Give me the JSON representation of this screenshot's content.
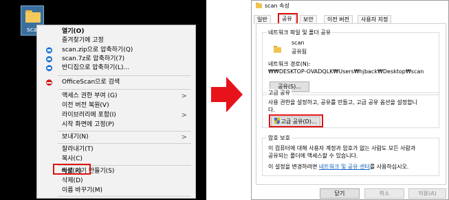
{
  "desktop": {
    "icon_label": "sca"
  },
  "context_menu": {
    "items": [
      {
        "label": "열기(O)",
        "bold": true
      },
      {
        "label": "즐겨찾기에 고정"
      },
      {
        "label": "scan.zip으로 압축하기(Q)",
        "icon": "bandizip-blue-icon"
      },
      {
        "label": "scan.7z로 압축하기(7)",
        "icon": "bandizip-blue-icon"
      },
      {
        "label": "반디집으로 압축하기(L)...",
        "icon": "bandizip-blue-icon"
      },
      {
        "label": "OfficeScan으로 검색",
        "icon": "officescan-red-icon"
      },
      {
        "label": "액세스 권한 부여 (G)",
        "submenu": true
      },
      {
        "label": "이전 버전 복원(V)"
      },
      {
        "label": "라이브러리에 포함(I)",
        "submenu": true
      },
      {
        "label": "시작 화면에 고정(P)"
      },
      {
        "label": "보내기(N)",
        "submenu": true
      },
      {
        "label": "잘라내기(T)"
      },
      {
        "label": "복사(C)"
      },
      {
        "label": "바로 가기 만들기(S)"
      },
      {
        "label": "삭제(D)"
      },
      {
        "label": "이름 바꾸기(M)"
      },
      {
        "label": "속성(R)",
        "highlighted": true
      }
    ]
  },
  "dialog": {
    "title": "scan 속성",
    "tabs": [
      "일반",
      "공유",
      "보안",
      "이전 버전",
      "사용자 지정"
    ],
    "active_tab": "공유",
    "network_sharing": {
      "group_title": "네트워크 파일 및 폴더 공유",
      "folder_name": "scan",
      "share_status": "공유됨",
      "path_label": "네트워크 경로(N):",
      "path_value": "₩₩DESKTOP-OVADQLK₩Users₩hjback₩Desktop₩scan",
      "share_button": "공유(S)..."
    },
    "advanced_sharing": {
      "group_title": "고급 공유",
      "description_line1": "사용 권한을 설정하고, 공유를 만들고, 고급 공유 옵션을 설정합니",
      "description_line2": "다.",
      "button": "고급 공유(D)..."
    },
    "password_protection": {
      "group_title": "암호 보호",
      "line1": "이 컴퓨터에 대해 사용자 계정과 암호가 없는 사람도 모든 사람과",
      "line2": "공유되는 폴더에 액세스할 수 있습니다.",
      "line3_prefix": "이 설정을 변경하려면 ",
      "line3_link": "네트워크 및 공유 센터",
      "line3_suffix": "를 사용하십시오."
    },
    "buttons": {
      "close": "닫기",
      "cancel": "취소",
      "apply": "적용(A)"
    }
  },
  "colors": {
    "highlight_border": "#e01010",
    "arrow_fill": "#e8121a",
    "link": "#0f5fbf"
  }
}
